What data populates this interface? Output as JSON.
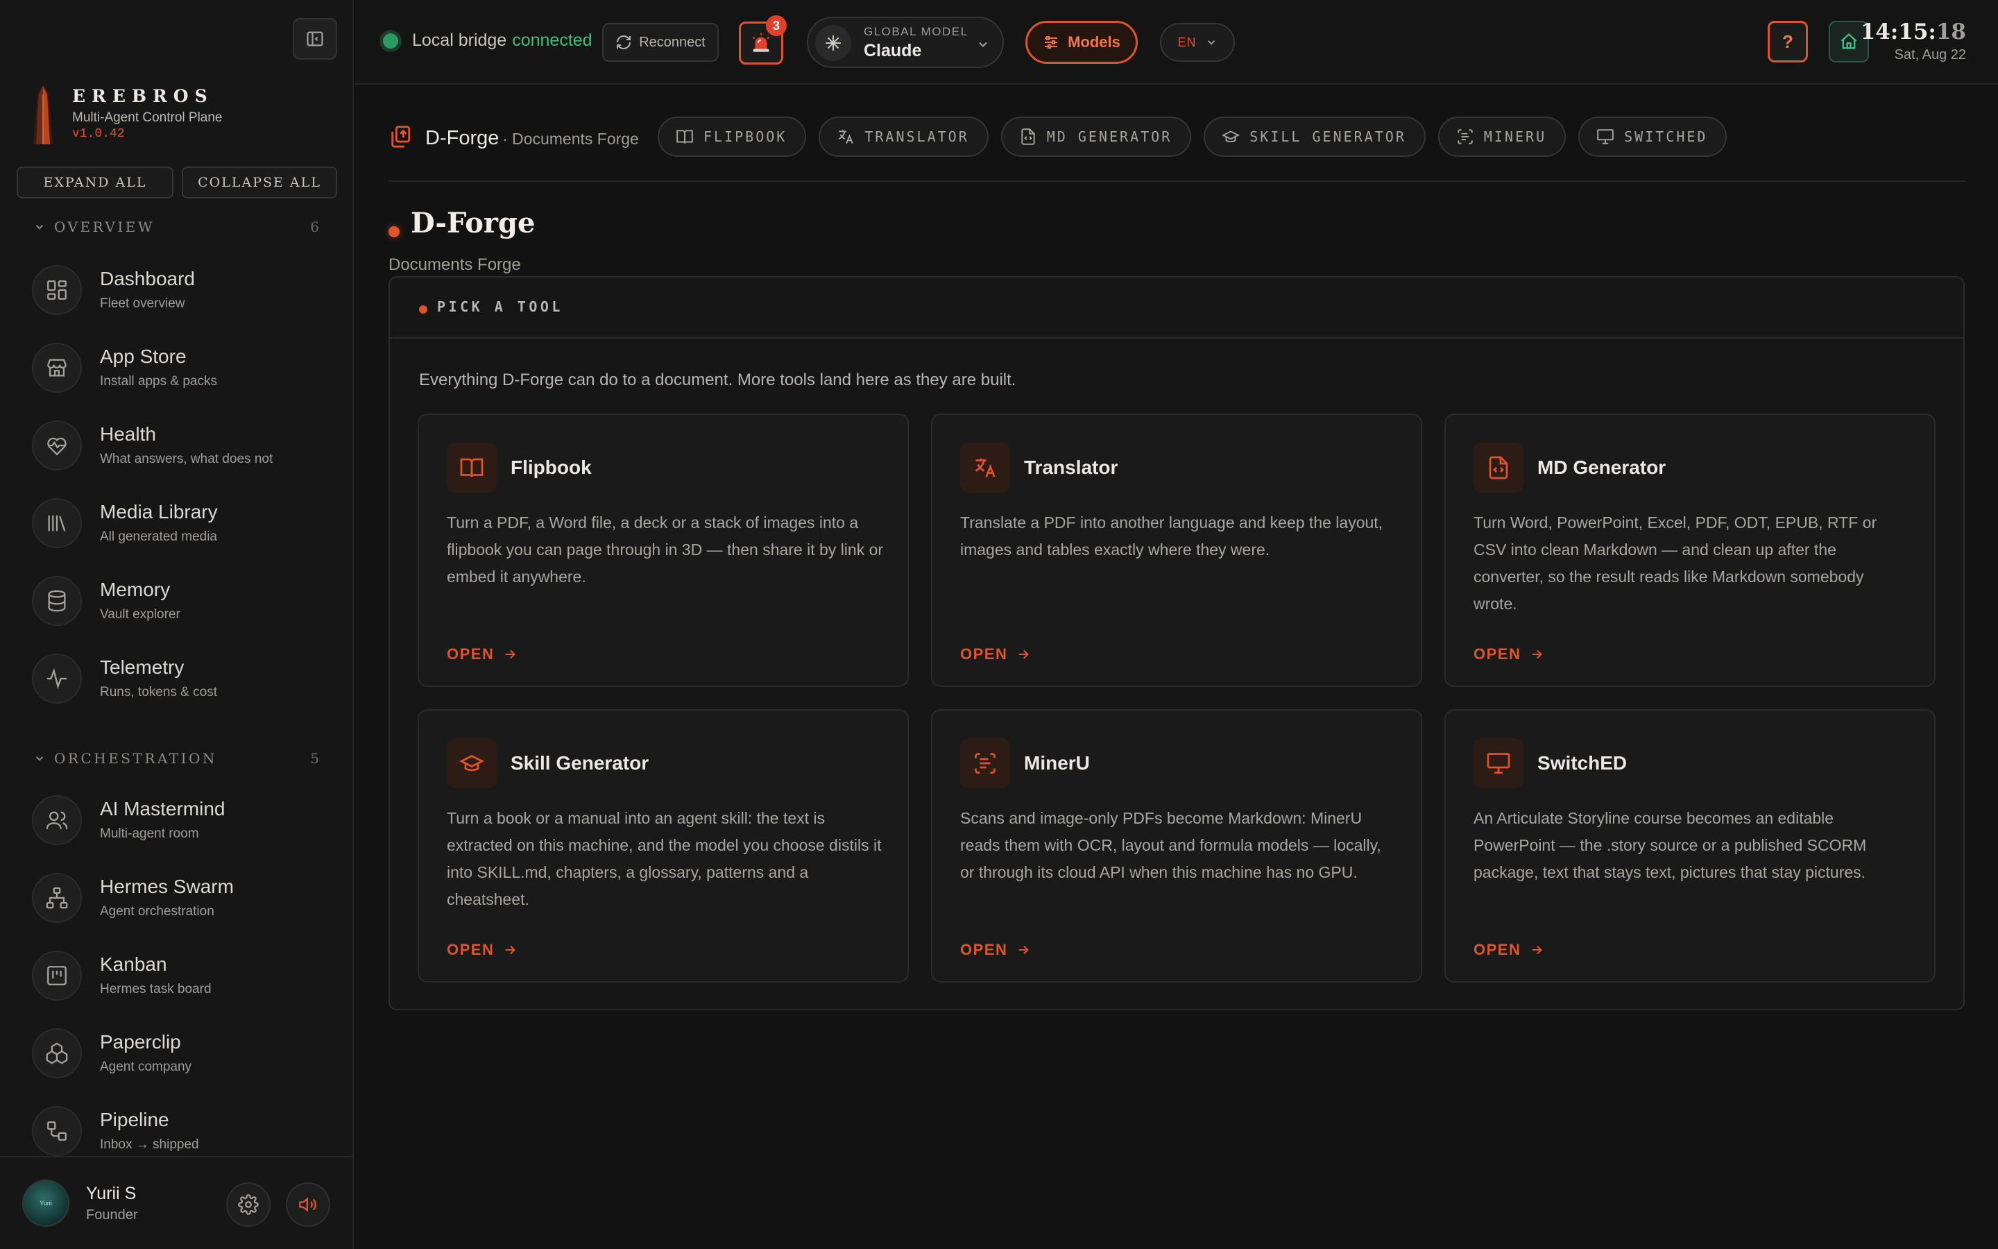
{
  "sidebar": {
    "brand": {
      "name": "EREBROS",
      "subtitle": "Multi-Agent Control Plane",
      "version": "v1.0.42"
    },
    "expand_all": "EXPAND ALL",
    "collapse_all": "COLLAPSE ALL",
    "sections": [
      {
        "label": "OVERVIEW",
        "count": "6",
        "items": [
          {
            "title": "Dashboard",
            "subtitle": "Fleet overview",
            "icon": "dashboard-icon"
          },
          {
            "title": "App Store",
            "subtitle": "Install apps & packs",
            "icon": "store-icon"
          },
          {
            "title": "Health",
            "subtitle": "What answers, what does not",
            "icon": "heart-pulse-icon"
          },
          {
            "title": "Media Library",
            "subtitle": "All generated media",
            "icon": "library-icon"
          },
          {
            "title": "Memory",
            "subtitle": "Vault explorer",
            "icon": "database-icon"
          },
          {
            "title": "Telemetry",
            "subtitle": "Runs, tokens & cost",
            "icon": "activity-icon"
          }
        ]
      },
      {
        "label": "ORCHESTRATION",
        "count": "5",
        "items": [
          {
            "title": "AI Mastermind",
            "subtitle": "Multi-agent room",
            "icon": "users-icon"
          },
          {
            "title": "Hermes Swarm",
            "subtitle": "Agent orchestration",
            "icon": "network-icon"
          },
          {
            "title": "Kanban",
            "subtitle": "Hermes task board",
            "icon": "kanban-icon"
          },
          {
            "title": "Paperclip",
            "subtitle": "Agent company",
            "icon": "boxes-icon"
          },
          {
            "title": "Pipeline",
            "subtitle": "Inbox → shipped",
            "icon": "pipeline-icon"
          }
        ]
      }
    ],
    "user": {
      "name": "Yurii S",
      "role": "Founder",
      "avatar_text": "Yurii"
    }
  },
  "topbar": {
    "bridge_label": "Local bridge",
    "bridge_status": "connected",
    "reconnect_label": "Reconnect",
    "alert_count": "3",
    "model_label": "GLOBAL MODEL",
    "model_name": "Claude",
    "models_button": "Models",
    "language": "EN",
    "help_label": "?",
    "clock_hm": "14:15:",
    "clock_sec": "18",
    "date": "Sat, Aug 22"
  },
  "breadcrumb": {
    "title": "D-Forge",
    "subtitle": "· Documents Forge",
    "tabs": [
      {
        "label": "FLIPBOOK",
        "icon": "book-icon"
      },
      {
        "label": "TRANSLATOR",
        "icon": "translate-icon"
      },
      {
        "label": "MD GENERATOR",
        "icon": "file-code-icon"
      },
      {
        "label": "SKILL GENERATOR",
        "icon": "graduation-cap-icon"
      },
      {
        "label": "MINERU",
        "icon": "scan-text-icon"
      },
      {
        "label": "SWITCHED",
        "icon": "presentation-icon"
      }
    ]
  },
  "page": {
    "title": "D-Forge",
    "subtitle": "Documents Forge",
    "panel_label": "PICK A TOOL",
    "panel_description": "Everything D-Forge can do to a document. More tools land here as they are built.",
    "open_label": "OPEN",
    "tools": [
      {
        "title": "Flipbook",
        "icon": "book-icon",
        "description": "Turn a PDF, a Word file, a deck or a stack of images into a flipbook you can page through in 3D — then share it by link or embed it anywhere."
      },
      {
        "title": "Translator",
        "icon": "translate-icon",
        "description": "Translate a PDF into another language and keep the layout, images and tables exactly where they were."
      },
      {
        "title": "MD Generator",
        "icon": "file-code-icon",
        "description": "Turn Word, PowerPoint, Excel, PDF, ODT, EPUB, RTF or CSV into clean Markdown — and clean up after the converter, so the result reads like Markdown somebody wrote."
      },
      {
        "title": "Skill Generator",
        "icon": "graduation-cap-icon",
        "description": "Turn a book or a manual into an agent skill: the text is extracted on this machine, and the model you choose distils it into SKILL.md, chapters, a glossary, patterns and a cheatsheet."
      },
      {
        "title": "MinerU",
        "icon": "scan-text-icon",
        "description": "Scans and image-only PDFs become Markdown: MinerU reads them with OCR, layout and formula models — locally, or through its cloud API when this machine has no GPU."
      },
      {
        "title": "SwitchED",
        "icon": "presentation-icon",
        "description": "An Articulate Storyline course becomes an editable PowerPoint — the .story source or a published SCORM package, text that stays text, pictures that stay pictures."
      }
    ]
  },
  "colors": {
    "accent": "#e0542c",
    "connected": "#3fbf7f",
    "background": "#121212"
  }
}
